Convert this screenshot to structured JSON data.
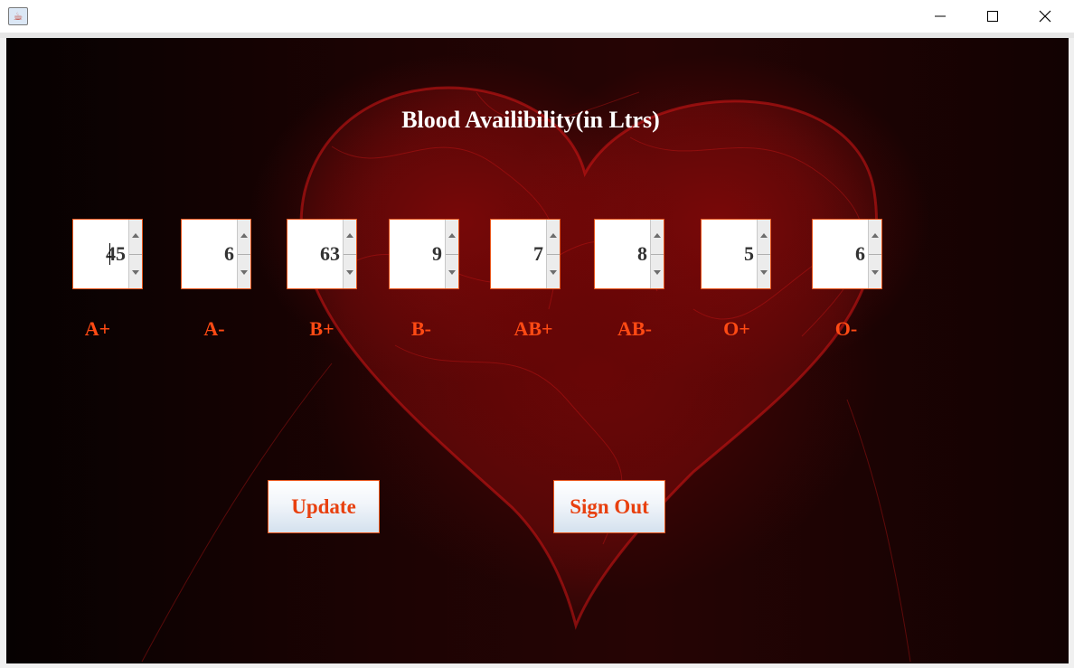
{
  "window": {
    "title": "",
    "app_icon": "java-icon",
    "controls": [
      "minimize-icon",
      "maximize-icon",
      "close-icon"
    ]
  },
  "title": "Blood Availibility(in Ltrs)",
  "blood_groups": [
    {
      "label": "A+",
      "value": "45"
    },
    {
      "label": "A-",
      "value": "6"
    },
    {
      "label": "B+",
      "value": "63"
    },
    {
      "label": "B-",
      "value": "9"
    },
    {
      "label": "AB+",
      "value": "7"
    },
    {
      "label": "AB-",
      "value": "8"
    },
    {
      "label": "O+",
      "value": "5"
    },
    {
      "label": "O-",
      "value": "6"
    }
  ],
  "buttons": {
    "update_label": "Update",
    "signout_label": "Sign Out"
  },
  "colors": {
    "label_color": "#ff4a14",
    "button_text": "#e8400f",
    "title_color": "#ffffff",
    "background": "#1a0303"
  }
}
